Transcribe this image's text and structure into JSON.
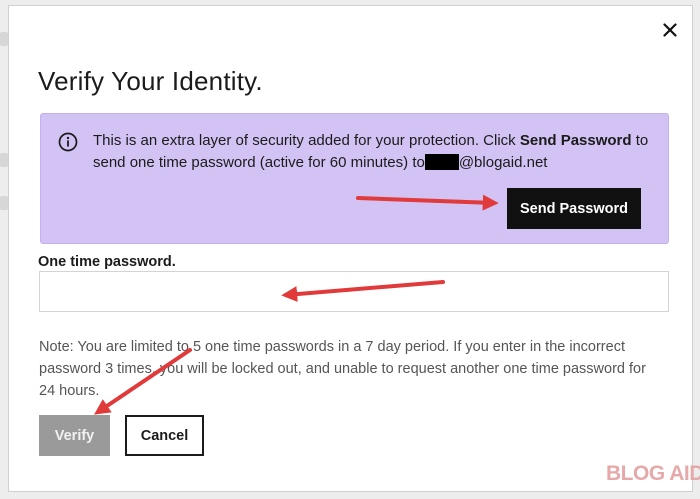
{
  "dialog": {
    "title": "Verify Your Identity.",
    "close_icon": "close-icon"
  },
  "info_panel": {
    "icon": "info-icon",
    "text_before_bold": "This is an extra layer of security added for your protection. Click ",
    "bold_text": "Send Password",
    "text_after_bold": " to send one time password (active for 60 minutes) to",
    "email_domain": "@blogaid.net",
    "send_button_label": "Send Password",
    "background_color": "#d3c2f4"
  },
  "otp": {
    "label": "One time password.",
    "value": "",
    "placeholder": ""
  },
  "note": {
    "text": "Note: You are limited to 5 one time passwords in a 7 day period. If you enter in the incorrect password 3 times, you will be locked out, and unable to request another one time password for 24 hours."
  },
  "actions": {
    "verify_label": "Verify",
    "cancel_label": "Cancel"
  },
  "watermark": {
    "text": "BLOG AID",
    "mark": "®"
  },
  "colors": {
    "annotation_arrow": "#e03a3a",
    "primary_button": "#111111",
    "disabled_button": "#9a9a9a"
  }
}
